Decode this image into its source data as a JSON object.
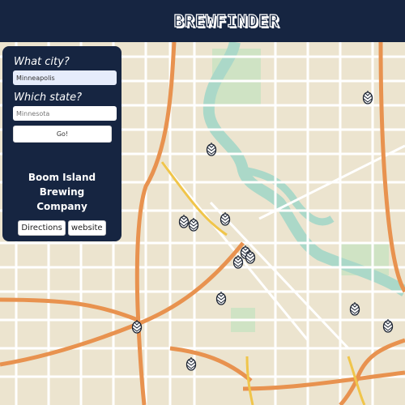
{
  "header": {
    "title": "BREWFINDER"
  },
  "search": {
    "city_label": "What city?",
    "city_value": "Minneapolis",
    "state_label": "Which state?",
    "state_placeholder": "Minnesota",
    "go_label": "Go!"
  },
  "selected": {
    "name": "Boom Island Brewing Company",
    "directions_label": "Directions",
    "website_label": "website"
  },
  "markers": {
    "icon": "hop-icon",
    "count": 14
  },
  "colors": {
    "navy": "#162541",
    "map_land": "#ece4cf",
    "river": "#abd8c8",
    "highway": "#e8924f"
  }
}
